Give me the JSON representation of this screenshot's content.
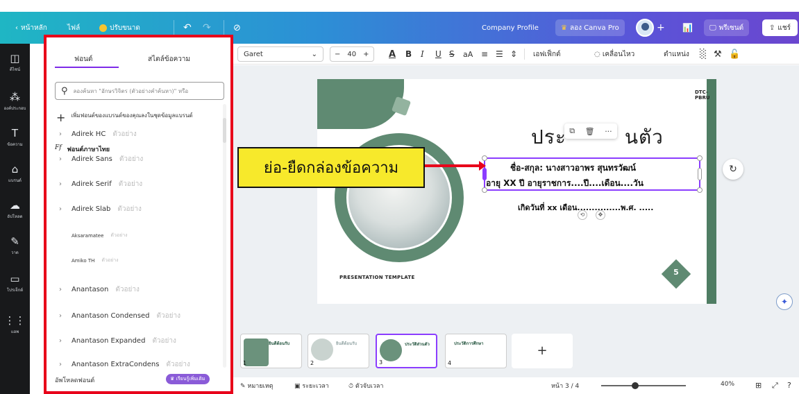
{
  "topbar": {
    "home": "หน้าหลัก",
    "file": "ไฟล์",
    "resize": "ปรับขนาด",
    "doc_title": "Company Profile",
    "try_pro": "ลอง Canva Pro",
    "present": "พรีเซนต์",
    "share": "แชร์"
  },
  "rail": [
    {
      "icon": "layout-icon",
      "label": "ดีไซน์"
    },
    {
      "icon": "elements-icon",
      "label": "องค์ประกอบ"
    },
    {
      "icon": "text-icon",
      "label": "ข้อความ"
    },
    {
      "icon": "brand-icon",
      "label": "แบรนด์"
    },
    {
      "icon": "upload-icon",
      "label": "อัปโหลด"
    },
    {
      "icon": "draw-icon",
      "label": "วาด"
    },
    {
      "icon": "folder-icon",
      "label": "โปรเจ็กต์"
    },
    {
      "icon": "apps-icon",
      "label": "แอพ"
    }
  ],
  "panel": {
    "tab_font": "ฟอนต์",
    "tab_text_style": "สไตล์ข้อความ",
    "search_placeholder": "ลองค้นหา \"อักษรวิจิตร (ตัวอย่างคำค้นหา)\" หรือ",
    "add_brand": "เพิ่มฟอนต์ของแบรนด์ของคุณลงในชุดข้อมูลแบรนด์",
    "section_title": "ฟอนต์ภาษาไทย",
    "fonts": [
      {
        "name": "Adirek HC",
        "sample": "ตัวอย่าง",
        "chevron": true
      },
      {
        "name": "Adirek Sans",
        "sample": "ตัวอย่าง",
        "chevron": true
      },
      {
        "name": "Adirek Serif",
        "sample": "ตัวอย่าง",
        "chevron": true
      },
      {
        "name": "Adirek Slab",
        "sample": "ตัวอย่าง",
        "chevron": true
      },
      {
        "name": "Aksaramatee",
        "sample": "ตัวอย่าง",
        "chevron": false
      },
      {
        "name": "Amiko TH",
        "sample": "ตัวอย่าง",
        "chevron": false
      },
      {
        "name": "Anantason",
        "sample": "ตัวอย่าง",
        "chevron": true
      },
      {
        "name": "Anantason Condensed",
        "sample": "ตัวอย่าง",
        "chevron": true
      },
      {
        "name": "Anantason Expanded",
        "sample": "ตัวอย่าง",
        "chevron": true
      },
      {
        "name": "Anantason ExtraCondens",
        "sample": "ตัวอย่าง",
        "chevron": true
      }
    ],
    "upload_font": "อัพโหลดฟอนต์",
    "learn_more": "เรียนรู้เพิ่มเติม"
  },
  "toolbar": {
    "font_name": "Garet",
    "font_size": "40",
    "effects": "เอฟเฟ็กต์",
    "animate": "เคลื่อนไหว",
    "position": "ตำแหน่ง"
  },
  "slide": {
    "badge": "DTC-PBRU",
    "title_left": "ประ",
    "title_right": "นตัว",
    "name_line": "ชื่อ-สกุล: นางสาวอาพร สุนทรวัฒน์",
    "age_line": "อายุ  XX  ปี อายุราชการ....ปี....เดือน....วัน",
    "birth_line": "เกิดวันที่ xx เดือน...............พ.ศ. .....",
    "footer_text": "PRESENTATION TEMPLATE",
    "page_number": "5"
  },
  "annotation": {
    "text": "ย่อ-ยืดกล่องข้อความ"
  },
  "thumbnails": [
    {
      "num": "1",
      "label": "ยินดีต้อนรับ"
    },
    {
      "num": "2",
      "label": "ยินดีต้อนรับ"
    },
    {
      "num": "3",
      "label": "ประวัติส่วนตัว"
    },
    {
      "num": "4",
      "label": "ประวัติการศึกษา"
    }
  ],
  "footer": {
    "notes": "หมายเหตุ",
    "duration": "ระยะเวลา",
    "timer": "ตัวจับเวลา",
    "page_indicator": "หน้า 3 / 4",
    "zoom": "40%",
    "zoom_fraction": 0.4
  },
  "colors": {
    "accent_green": "#5f8a72",
    "selection_purple": "#8b3dff",
    "annotation_yellow": "#f7e92b",
    "highlight_red": "#e8001a"
  }
}
